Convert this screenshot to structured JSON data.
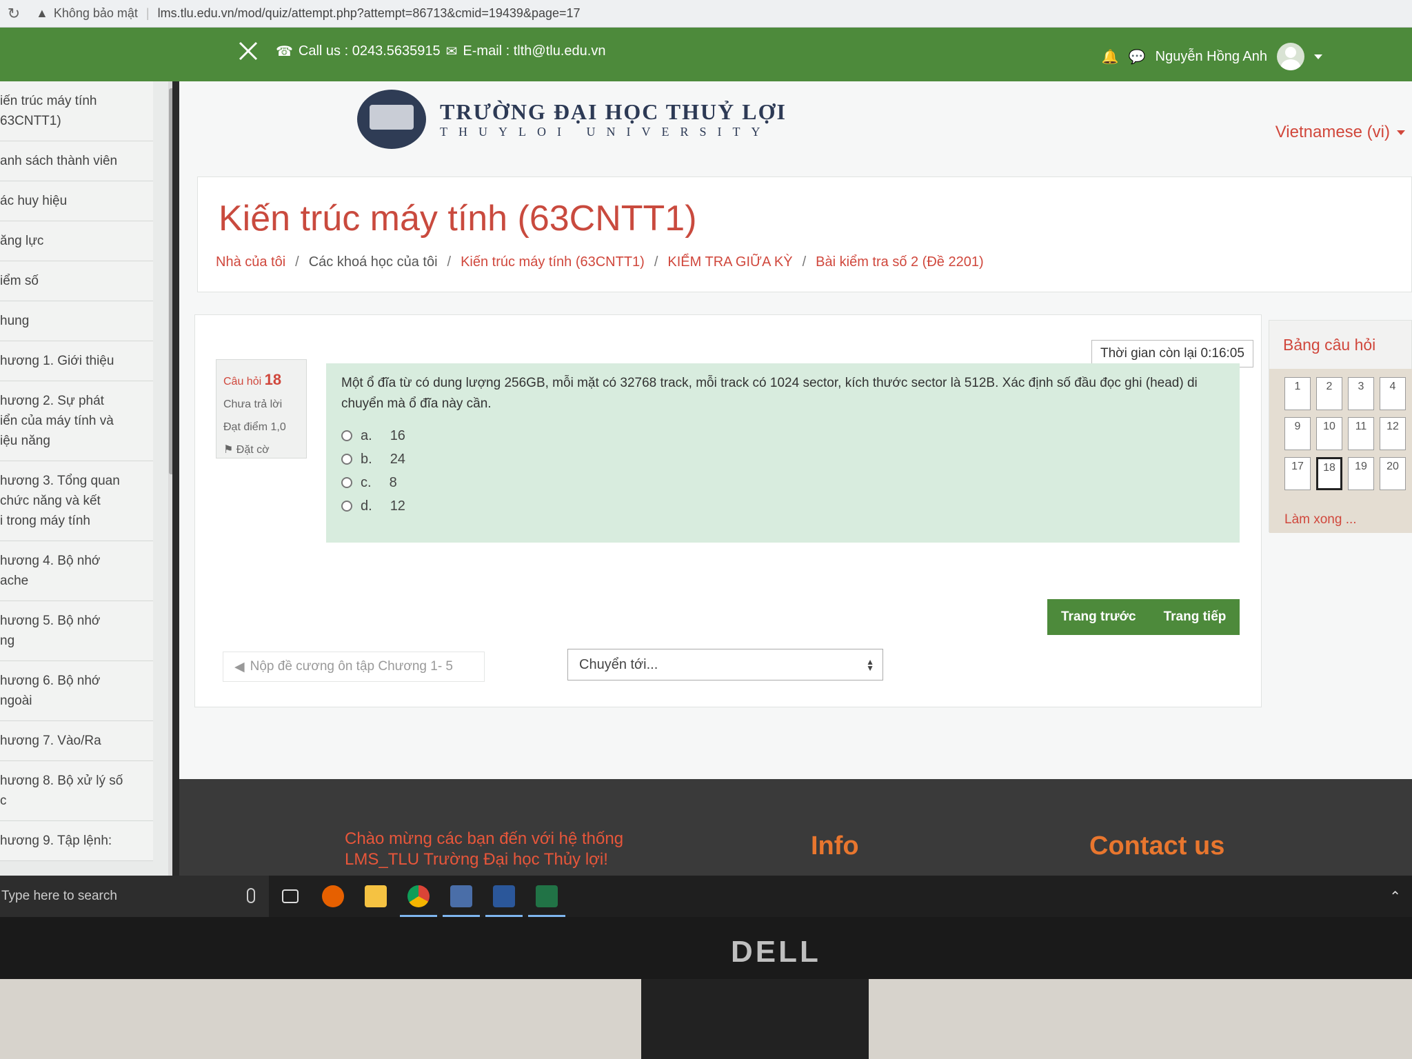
{
  "browser": {
    "security": "Không bảo mật",
    "url": "lms.tlu.edu.vn/mod/quiz/attempt.php?attempt=86713&cmid=19439&page=17"
  },
  "topbar": {
    "contact": "Call us : 0243.5635915",
    "email": "E-mail : tlth@tlu.edu.vn",
    "user": "Nguyễn Hồng Anh"
  },
  "sidebar": {
    "items": [
      "iến trúc máy tính\n63CNTT1)",
      "anh sách thành viên",
      "ác huy hiệu",
      "ăng lực",
      "iểm số",
      "hung",
      "hương 1. Giới thiệu",
      "hương 2. Sự phát\niển của máy tính và\niệu năng",
      "hương 3. Tổng quan\nchức năng và kết\ni trong máy tính",
      "hương 4. Bộ nhớ\nache",
      "hương 5. Bộ nhớ\nng",
      "hương 6. Bộ nhớ\nngoài",
      "hương 7. Vào/Ra",
      "hương 8. Bộ xử lý số\nc",
      "hương 9. Tập lệnh:"
    ]
  },
  "header": {
    "uni_name": "TRƯỜNG ĐẠI HỌC THUỶ LỢI",
    "uni_name_en": "THUYLOI UNIVERSITY",
    "language": "Vietnamese (vi)"
  },
  "course": {
    "title": "Kiến trúc máy tính (63CNTT1)",
    "breadcrumb": [
      "Nhà của tôi",
      "Các khoá học của tôi",
      "Kiến trúc máy tính (63CNTT1)",
      "KIỂM TRA GIỮA KỲ",
      "Bài kiểm tra số 2 (Đề 2201)"
    ]
  },
  "quiz": {
    "timer": "Thời gian còn lại 0:16:05",
    "question_label": "Câu hỏi",
    "question_number": "18",
    "status": "Chưa trả lời",
    "score": "Đạt điểm 1,0",
    "flag": "Đặt cờ",
    "question_text": "Một ổ đĩa từ có dung lượng 256GB, mỗi mặt có 32768 track, mỗi track có 1024 sector, kích thước sector là 512B. Xác định số đầu đọc ghi (head) di chuyển mà ổ đĩa này cần.",
    "options": [
      {
        "letter": "a.",
        "value": "16"
      },
      {
        "letter": "b.",
        "value": "24"
      },
      {
        "letter": "c.",
        "value": "8"
      },
      {
        "letter": "d.",
        "value": "12"
      }
    ],
    "prev_button": "Trang trước",
    "next_button": "Trang tiếp",
    "prev_activity": "Nộp đề cương ôn tập Chương 1- 5",
    "jump_placeholder": "Chuyển tới..."
  },
  "quiz_nav": {
    "title": "Bảng câu hỏi",
    "numbers": [
      "1",
      "2",
      "3",
      "4",
      "9",
      "10",
      "11",
      "12",
      "17",
      "18",
      "19",
      "20"
    ],
    "current": "18",
    "finish": "Làm xong ..."
  },
  "footer": {
    "welcome": "Chào mừng các bạn đến với hệ thống LMS_TLU Trường Đại học Thủy lợi!",
    "info": "Info",
    "contact": "Contact us"
  },
  "taskbar": {
    "search": "Type here to search"
  },
  "monitor": {
    "brand": "DELL"
  }
}
